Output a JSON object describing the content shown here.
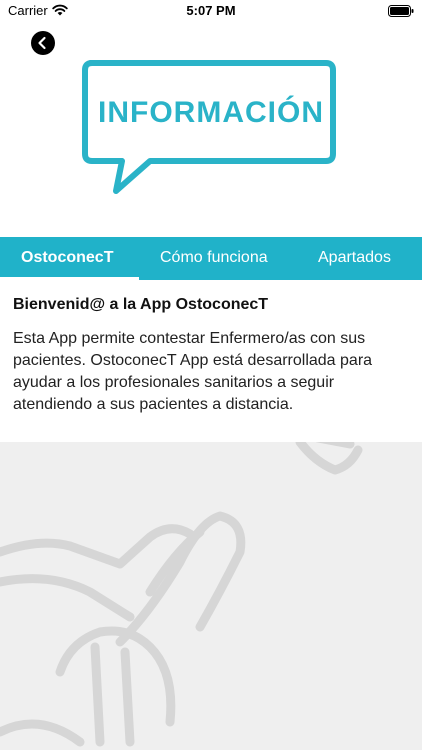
{
  "status_bar": {
    "carrier": "Carrier",
    "time": "5:07 PM"
  },
  "header": {
    "logo_text": "INFORMACIÓN"
  },
  "tabs": [
    {
      "label": "OstoconecT",
      "active": true
    },
    {
      "label": "Cómo funciona",
      "active": false
    },
    {
      "label": "Apartados",
      "active": false
    }
  ],
  "content": {
    "welcome": "Bienvenid@ a la App OstoconecT",
    "description": "Esta App permite contestar Enfermero/as con sus pacientes.  OstoconecT App está desarrollada para ayudar a los profesionales sanitarios a seguir atendiendo a sus pacientes a distancia."
  },
  "colors": {
    "accent": "#20b2c9",
    "logo": "#2ab3c8",
    "background_art": "#efefef"
  },
  "icons": {
    "back": "chevron-left-icon",
    "wifi": "wifi-icon",
    "battery": "battery-icon"
  }
}
